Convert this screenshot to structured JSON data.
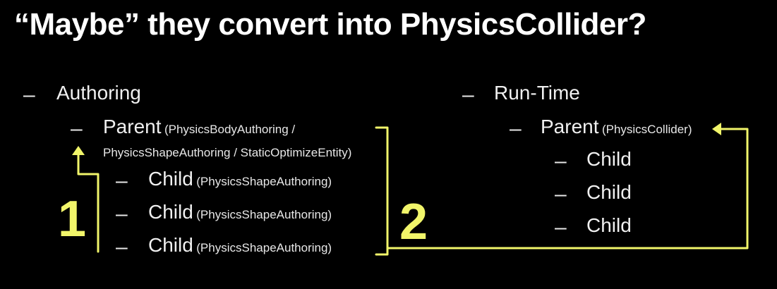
{
  "slide": {
    "title": "“Maybe” they convert into PhysicsCollider?",
    "dash": "–",
    "left": {
      "heading": "Authoring",
      "parent": {
        "label": "Parent",
        "detail_line1": "(PhysicsBodyAuthoring /",
        "detail_line2": "PhysicsShapeAuthoring / StaticOptimizeEntity)"
      },
      "children": [
        {
          "label": "Child",
          "detail": "(PhysicsShapeAuthoring)"
        },
        {
          "label": "Child",
          "detail": "(PhysicsShapeAuthoring)"
        },
        {
          "label": "Child",
          "detail": "(PhysicsShapeAuthoring)"
        }
      ]
    },
    "right": {
      "heading": "Run-Time",
      "parent": {
        "label": "Parent",
        "detail": "(PhysicsCollider)"
      },
      "children": [
        {
          "label": "Child"
        },
        {
          "label": "Child"
        },
        {
          "label": "Child"
        }
      ]
    },
    "annotations": {
      "step1": "1",
      "step2": "2",
      "color": "#f1f56a"
    }
  }
}
